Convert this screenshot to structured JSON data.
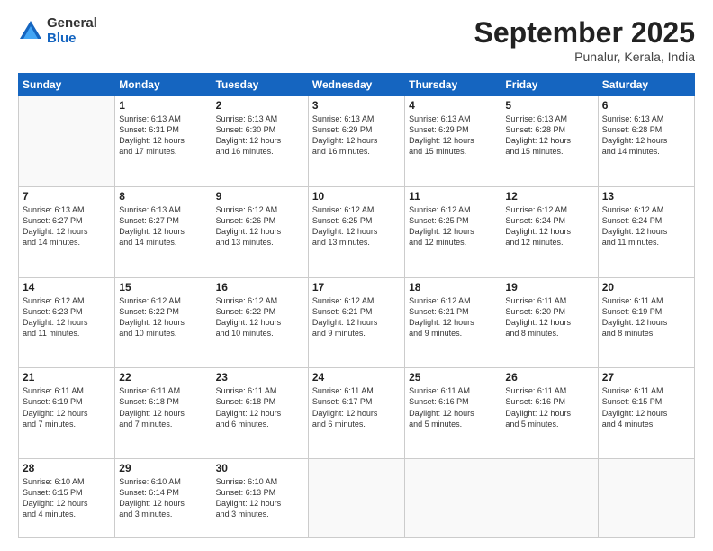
{
  "logo": {
    "general": "General",
    "blue": "Blue"
  },
  "header": {
    "month": "September 2025",
    "location": "Punalur, Kerala, India"
  },
  "weekdays": [
    "Sunday",
    "Monday",
    "Tuesday",
    "Wednesday",
    "Thursday",
    "Friday",
    "Saturday"
  ],
  "weeks": [
    [
      {
        "day": "",
        "info": ""
      },
      {
        "day": "1",
        "info": "Sunrise: 6:13 AM\nSunset: 6:31 PM\nDaylight: 12 hours\nand 17 minutes."
      },
      {
        "day": "2",
        "info": "Sunrise: 6:13 AM\nSunset: 6:30 PM\nDaylight: 12 hours\nand 16 minutes."
      },
      {
        "day": "3",
        "info": "Sunrise: 6:13 AM\nSunset: 6:29 PM\nDaylight: 12 hours\nand 16 minutes."
      },
      {
        "day": "4",
        "info": "Sunrise: 6:13 AM\nSunset: 6:29 PM\nDaylight: 12 hours\nand 15 minutes."
      },
      {
        "day": "5",
        "info": "Sunrise: 6:13 AM\nSunset: 6:28 PM\nDaylight: 12 hours\nand 15 minutes."
      },
      {
        "day": "6",
        "info": "Sunrise: 6:13 AM\nSunset: 6:28 PM\nDaylight: 12 hours\nand 14 minutes."
      }
    ],
    [
      {
        "day": "7",
        "info": "Sunrise: 6:13 AM\nSunset: 6:27 PM\nDaylight: 12 hours\nand 14 minutes."
      },
      {
        "day": "8",
        "info": "Sunrise: 6:13 AM\nSunset: 6:27 PM\nDaylight: 12 hours\nand 14 minutes."
      },
      {
        "day": "9",
        "info": "Sunrise: 6:12 AM\nSunset: 6:26 PM\nDaylight: 12 hours\nand 13 minutes."
      },
      {
        "day": "10",
        "info": "Sunrise: 6:12 AM\nSunset: 6:25 PM\nDaylight: 12 hours\nand 13 minutes."
      },
      {
        "day": "11",
        "info": "Sunrise: 6:12 AM\nSunset: 6:25 PM\nDaylight: 12 hours\nand 12 minutes."
      },
      {
        "day": "12",
        "info": "Sunrise: 6:12 AM\nSunset: 6:24 PM\nDaylight: 12 hours\nand 12 minutes."
      },
      {
        "day": "13",
        "info": "Sunrise: 6:12 AM\nSunset: 6:24 PM\nDaylight: 12 hours\nand 11 minutes."
      }
    ],
    [
      {
        "day": "14",
        "info": "Sunrise: 6:12 AM\nSunset: 6:23 PM\nDaylight: 12 hours\nand 11 minutes."
      },
      {
        "day": "15",
        "info": "Sunrise: 6:12 AM\nSunset: 6:22 PM\nDaylight: 12 hours\nand 10 minutes."
      },
      {
        "day": "16",
        "info": "Sunrise: 6:12 AM\nSunset: 6:22 PM\nDaylight: 12 hours\nand 10 minutes."
      },
      {
        "day": "17",
        "info": "Sunrise: 6:12 AM\nSunset: 6:21 PM\nDaylight: 12 hours\nand 9 minutes."
      },
      {
        "day": "18",
        "info": "Sunrise: 6:12 AM\nSunset: 6:21 PM\nDaylight: 12 hours\nand 9 minutes."
      },
      {
        "day": "19",
        "info": "Sunrise: 6:11 AM\nSunset: 6:20 PM\nDaylight: 12 hours\nand 8 minutes."
      },
      {
        "day": "20",
        "info": "Sunrise: 6:11 AM\nSunset: 6:19 PM\nDaylight: 12 hours\nand 8 minutes."
      }
    ],
    [
      {
        "day": "21",
        "info": "Sunrise: 6:11 AM\nSunset: 6:19 PM\nDaylight: 12 hours\nand 7 minutes."
      },
      {
        "day": "22",
        "info": "Sunrise: 6:11 AM\nSunset: 6:18 PM\nDaylight: 12 hours\nand 7 minutes."
      },
      {
        "day": "23",
        "info": "Sunrise: 6:11 AM\nSunset: 6:18 PM\nDaylight: 12 hours\nand 6 minutes."
      },
      {
        "day": "24",
        "info": "Sunrise: 6:11 AM\nSunset: 6:17 PM\nDaylight: 12 hours\nand 6 minutes."
      },
      {
        "day": "25",
        "info": "Sunrise: 6:11 AM\nSunset: 6:16 PM\nDaylight: 12 hours\nand 5 minutes."
      },
      {
        "day": "26",
        "info": "Sunrise: 6:11 AM\nSunset: 6:16 PM\nDaylight: 12 hours\nand 5 minutes."
      },
      {
        "day": "27",
        "info": "Sunrise: 6:11 AM\nSunset: 6:15 PM\nDaylight: 12 hours\nand 4 minutes."
      }
    ],
    [
      {
        "day": "28",
        "info": "Sunrise: 6:10 AM\nSunset: 6:15 PM\nDaylight: 12 hours\nand 4 minutes."
      },
      {
        "day": "29",
        "info": "Sunrise: 6:10 AM\nSunset: 6:14 PM\nDaylight: 12 hours\nand 3 minutes."
      },
      {
        "day": "30",
        "info": "Sunrise: 6:10 AM\nSunset: 6:13 PM\nDaylight: 12 hours\nand 3 minutes."
      },
      {
        "day": "",
        "info": ""
      },
      {
        "day": "",
        "info": ""
      },
      {
        "day": "",
        "info": ""
      },
      {
        "day": "",
        "info": ""
      }
    ]
  ]
}
